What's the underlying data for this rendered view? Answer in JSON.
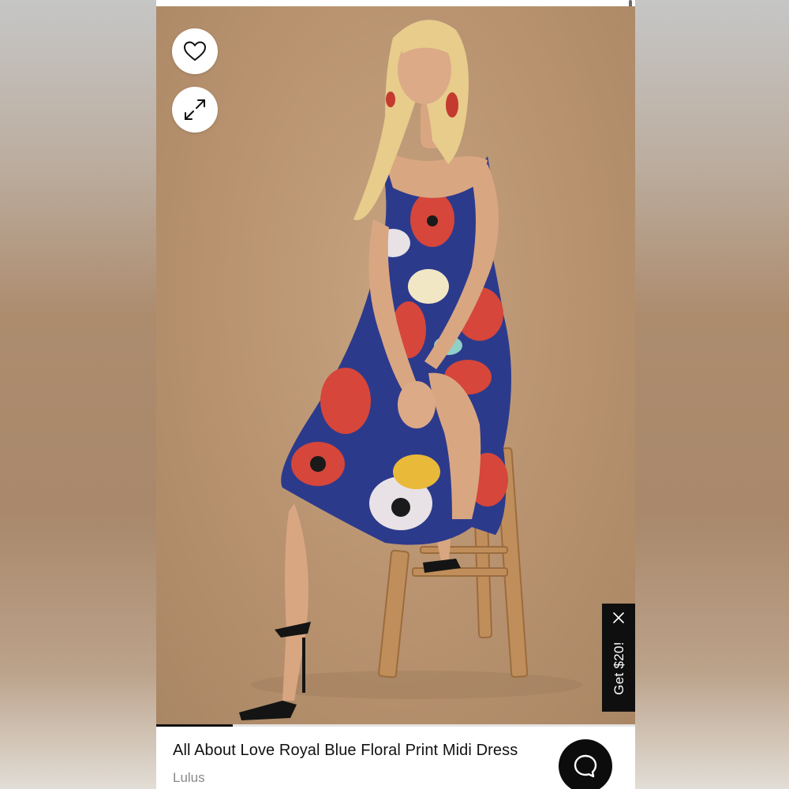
{
  "product": {
    "title": "All About Love Royal Blue Floral Print Midi Dress",
    "brand": "Lulus"
  },
  "gallery": {
    "progress": 0.16,
    "favorite_icon": "heart-icon",
    "expand_icon": "expand-icon"
  },
  "promo": {
    "label": "Get $20!",
    "close_icon": "close-icon"
  },
  "chat": {
    "icon": "chat-bubble-icon"
  },
  "colors": {
    "background": "#b8926f",
    "dress_blue": "#2c3a8c",
    "dress_red": "#d6463a",
    "promo_bg": "#0f0f0f"
  }
}
